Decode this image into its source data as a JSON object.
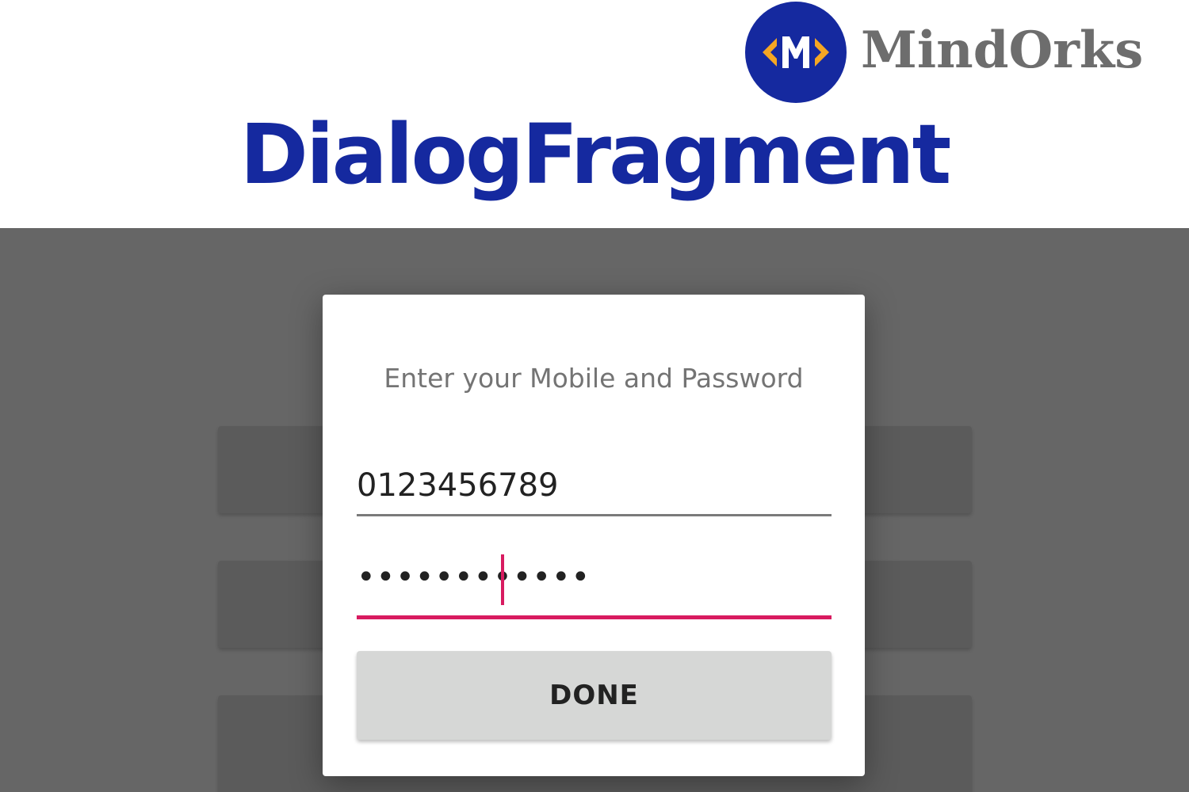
{
  "banner": {
    "brand_name": "MindOrks",
    "brand_logo_icon": "mindorks-m-logo-icon",
    "title": "DialogFragment"
  },
  "dialog": {
    "title": "Enter your Mobile and Password",
    "mobile_value": "0123456789",
    "password_value": "••••••••••••",
    "done_label": "DONE"
  },
  "colors": {
    "brand_blue": "#15299f",
    "brand_gray": "#6d6d6d",
    "logo_accent": "#f5a623",
    "scrim": "#666666",
    "focus_accent": "#d81b60",
    "button_gray": "#d6d7d6"
  }
}
